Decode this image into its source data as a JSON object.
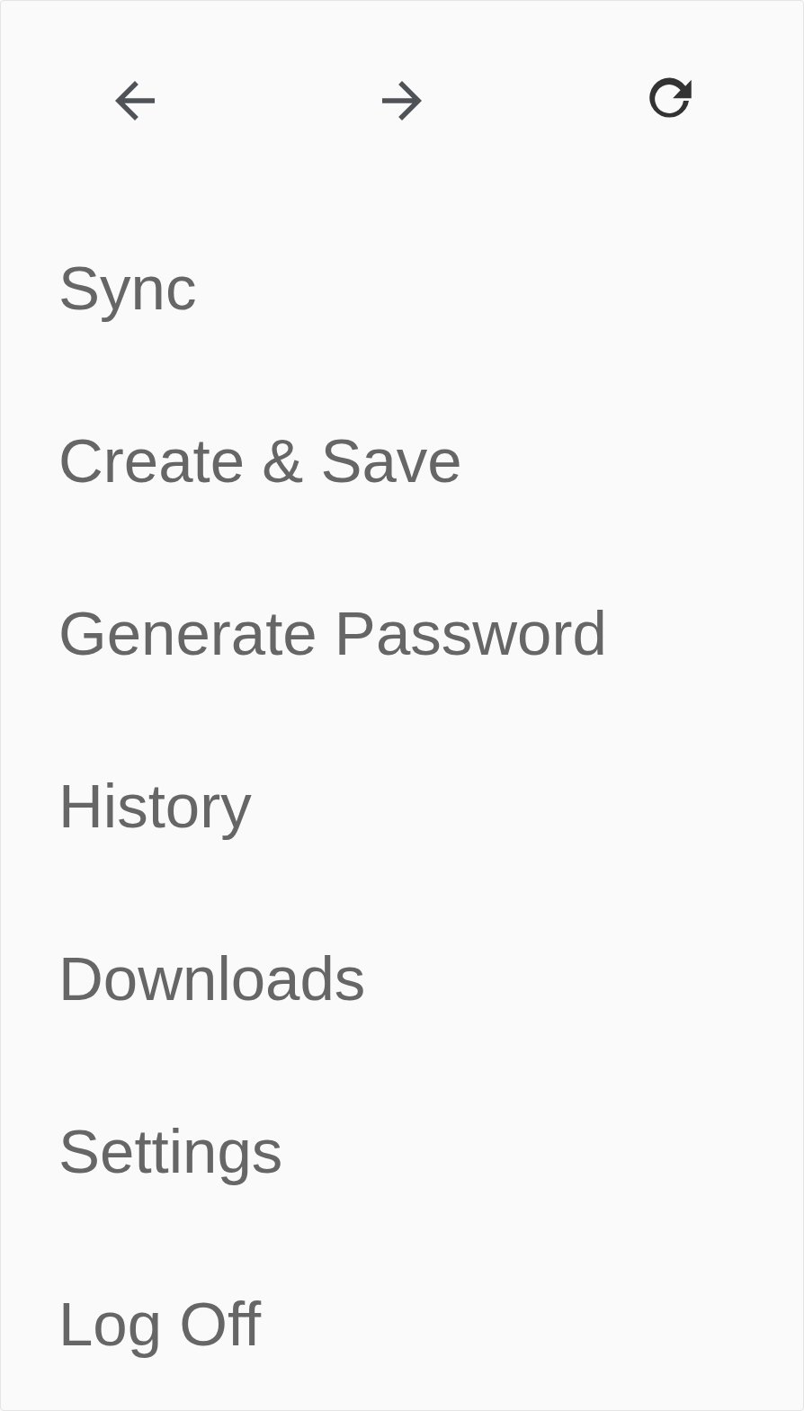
{
  "menu": {
    "items": [
      {
        "label": "Sync"
      },
      {
        "label": "Create & Save"
      },
      {
        "label": "Generate Password"
      },
      {
        "label": "History"
      },
      {
        "label": "Downloads"
      },
      {
        "label": "Settings"
      },
      {
        "label": "Log Off"
      }
    ]
  }
}
